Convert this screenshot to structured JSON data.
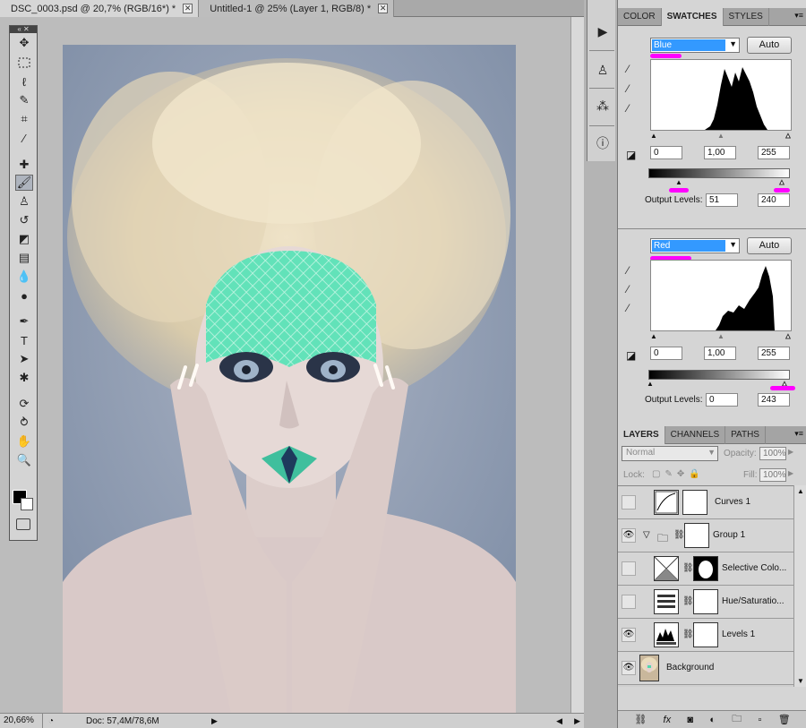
{
  "document_tabs": [
    {
      "label": "DSC_0003.psd @ 20,7% (RGB/16*) *",
      "close": "✕"
    },
    {
      "label": "Untitled-1 @ 25% (Layer 1, RGB/8) *",
      "close": "✕"
    }
  ],
  "tools_header": "« ✕",
  "tools": [
    "move-tool",
    "marquee-tool",
    "lasso-tool",
    "quick-select-tool",
    "crop-tool",
    "eyedropper-tool",
    "healing-tool",
    "brush-tool",
    "clone-stamp-tool",
    "history-brush-tool",
    "eraser-tool",
    "gradient-tool",
    "blur-tool",
    "dodge-tool",
    "pen-tool",
    "type-tool",
    "path-select-tool",
    "shape-tool",
    "3d-rotate-tool",
    "3d-orbit-tool",
    "hand-tool",
    "zoom-tool"
  ],
  "status": {
    "zoom": "20,66%",
    "doc": "Doc: 57,4M/78,6M"
  },
  "dock_icons": [
    "actions-icon",
    "clone-source-icon",
    "brushes-icon",
    "info-icon"
  ],
  "color_panel": {
    "tabs": [
      "COLOR",
      "SWATCHES",
      "STYLES"
    ],
    "active_tab": "SWATCHES"
  },
  "levels_blue": {
    "channel": "Blue",
    "auto_label": "Auto",
    "input": [
      "0",
      "1,00",
      "255"
    ],
    "output_label": "Output Levels:",
    "output": [
      "51",
      "240"
    ]
  },
  "levels_red": {
    "channel": "Red",
    "auto_label": "Auto",
    "input": [
      "0",
      "1,00",
      "255"
    ],
    "output_label": "Output Levels:",
    "output": [
      "0",
      "243"
    ]
  },
  "layers_panel": {
    "tabs": [
      "LAYERS",
      "CHANNELS",
      "PATHS"
    ],
    "active_tab": "LAYERS",
    "blend_mode": "Normal",
    "opacity_label": "Opacity:",
    "opacity": "100%",
    "lock_label": "Lock:",
    "fill_label": "Fill:",
    "fill": "100%",
    "layers": [
      {
        "name": "Curves 1",
        "visible": false
      },
      {
        "name": "Group 1",
        "visible": true
      },
      {
        "name": "Selective Colo...",
        "visible": false
      },
      {
        "name": "Hue/Saturatio...",
        "visible": false
      },
      {
        "name": "Levels 1",
        "visible": true
      },
      {
        "name": "Background",
        "visible": true
      }
    ]
  },
  "colors": {
    "highlight": "#3399ff",
    "annotation": "#ff00ff",
    "face_paint": "#5fe0b8"
  }
}
